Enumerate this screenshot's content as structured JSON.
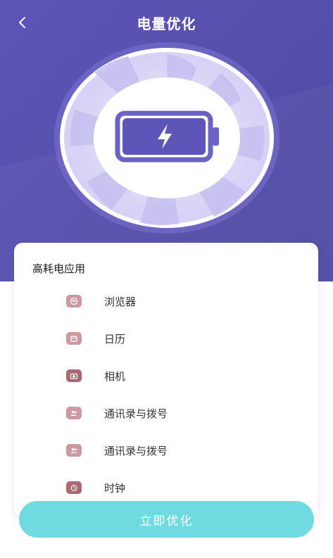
{
  "header": {
    "title": "电量优化",
    "back_icon": "chevron-left-icon"
  },
  "colors": {
    "header_bg": "#5853b0",
    "battery_accent": "#5d55b8",
    "button_bg": "#6fdbe0",
    "icon_bg": "#c88a94"
  },
  "battery": {
    "icon": "battery-charging-icon"
  },
  "high_power_apps": {
    "title": "高耗电应用",
    "items": [
      {
        "label": "浏览器",
        "icon": "browser-icon"
      },
      {
        "label": "日历",
        "icon": "calendar-icon"
      },
      {
        "label": "相机",
        "icon": "camera-icon"
      },
      {
        "label": "通讯录与拨号",
        "icon": "contacts-icon"
      },
      {
        "label": "通讯录与拨号",
        "icon": "contacts-icon"
      },
      {
        "label": "时钟",
        "icon": "clock-icon"
      }
    ]
  },
  "actions": {
    "optimize_label": "立即优化"
  }
}
